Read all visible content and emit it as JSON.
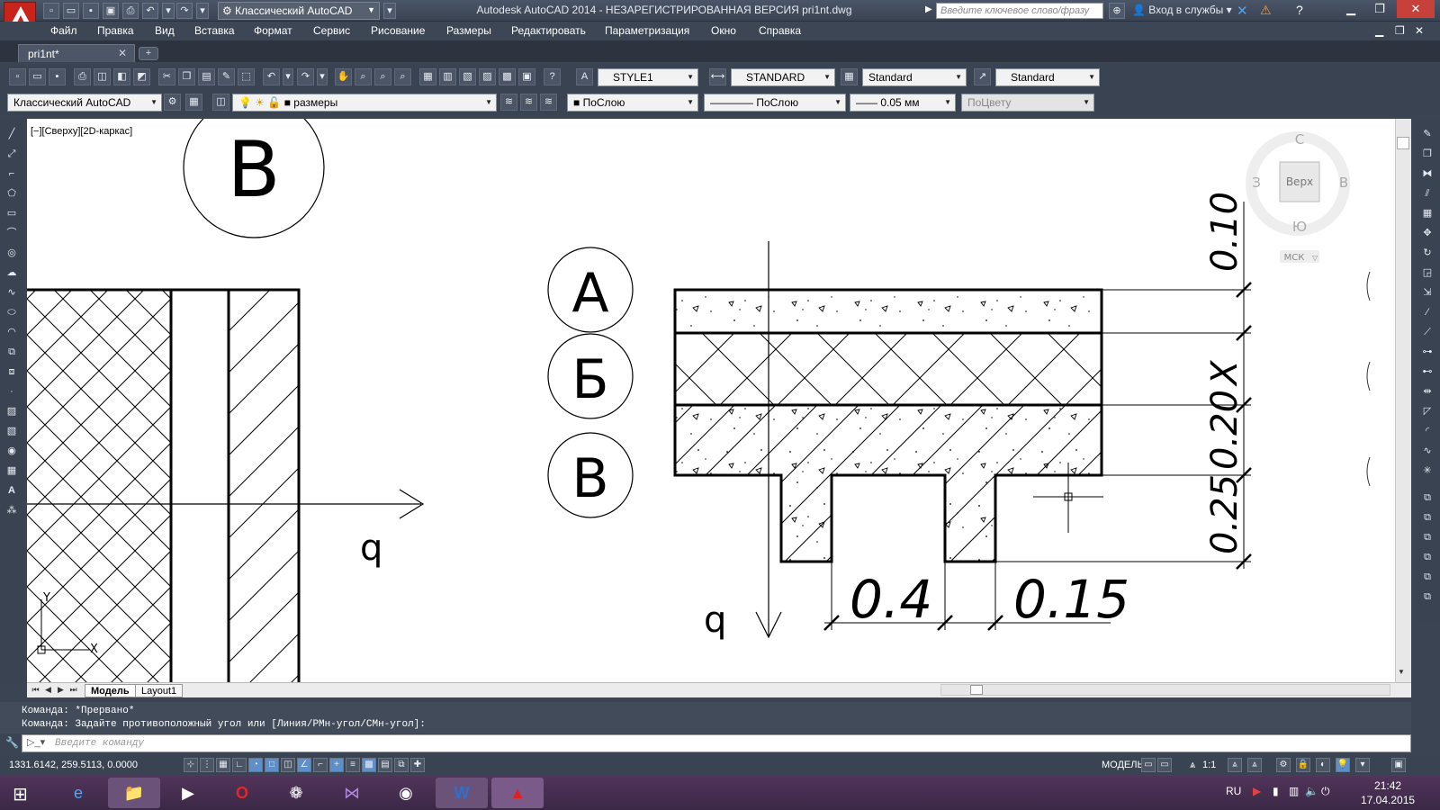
{
  "titlebar": {
    "workspace": "Классический AutoCAD",
    "title": "Autodesk AutoCAD 2014 - НЕЗАРЕГИСТРИРОВАННАЯ ВЕРСИЯ     pri1nt.dwg",
    "search_placeholder": "Введите ключевое слово/фразу",
    "signin": "Вход в службы"
  },
  "menu": [
    "Файл",
    "Правка",
    "Вид",
    "Вставка",
    "Формат",
    "Сервис",
    "Рисование",
    "Размеры",
    "Редактировать",
    "Параметризация",
    "Окно",
    "Справка"
  ],
  "tabs": {
    "document": "pri1nt*",
    "new": "+"
  },
  "toolbar1": {
    "text_style": "STYLE1",
    "dim_style": "STANDARD",
    "table_style": "Standard",
    "mleader_style": "Standard"
  },
  "toolbar2": {
    "workspace": "Классический AutoCAD",
    "layer": "размеры",
    "color": "ПоСлою",
    "linetype": "ПоСлою",
    "lineweight": "0.05 мм",
    "plotstyle": "ПоЦвету"
  },
  "viewport": {
    "label": "[−][Сверху][2D-каркас]"
  },
  "viewcube": {
    "north": "С",
    "south": "Ю",
    "west": "З",
    "east": "В",
    "face": "Верх",
    "ucs": "МСК"
  },
  "drawing": {
    "bubbles": [
      "А",
      "Б",
      "В"
    ],
    "top_bubble": "В",
    "load_label": "q",
    "dims_right": [
      "0.10",
      "X",
      "0.20",
      "0.25"
    ],
    "dims_bottom": [
      "0.4",
      "0.15"
    ],
    "axis_y": "Y",
    "axis_x": "X"
  },
  "layouts": [
    "Модель",
    "Layout1"
  ],
  "command": {
    "history": [
      "Команда: *Прервано*",
      "Команда: Задайте противоположный угол или [Линия/РМн-угол/СМн-угол]:"
    ],
    "placeholder": "Введите команду"
  },
  "status": {
    "coords": "1331.6142, 259.5113, 0.0000",
    "space": "МОДЕЛЬ",
    "scale": "1:1"
  },
  "taskbar": {
    "lang": "RU",
    "time": "21:42",
    "date": "17.04.2015"
  }
}
